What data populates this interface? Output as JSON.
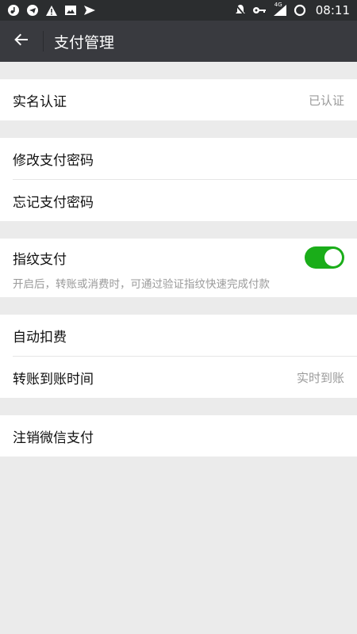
{
  "status_bar": {
    "time": "08:11",
    "network_label": "4G",
    "left_icons": [
      "music-icon",
      "telegram-icon",
      "warning-icon",
      "image-icon",
      "send-icon"
    ],
    "right_icons": [
      "notifications-off-icon",
      "key-icon",
      "signal-icon",
      "sync-icon"
    ]
  },
  "header": {
    "title": "支付管理",
    "back_icon": "back-arrow-icon"
  },
  "sections": {
    "verify": {
      "label": "实名认证",
      "value": "已认证"
    },
    "password": {
      "change_label": "修改支付密码",
      "forgot_label": "忘记支付密码"
    },
    "fingerprint": {
      "label": "指纹支付",
      "hint": "开启后，转账或消费时，可通过验证指纹快速完成付款",
      "enabled": true,
      "toggle_color": "#1aad19"
    },
    "auto": {
      "auto_pay_label": "自动扣费",
      "transfer_time_label": "转账到账时间",
      "transfer_time_value": "实时到账"
    },
    "cancel": {
      "label": "注销微信支付"
    }
  }
}
